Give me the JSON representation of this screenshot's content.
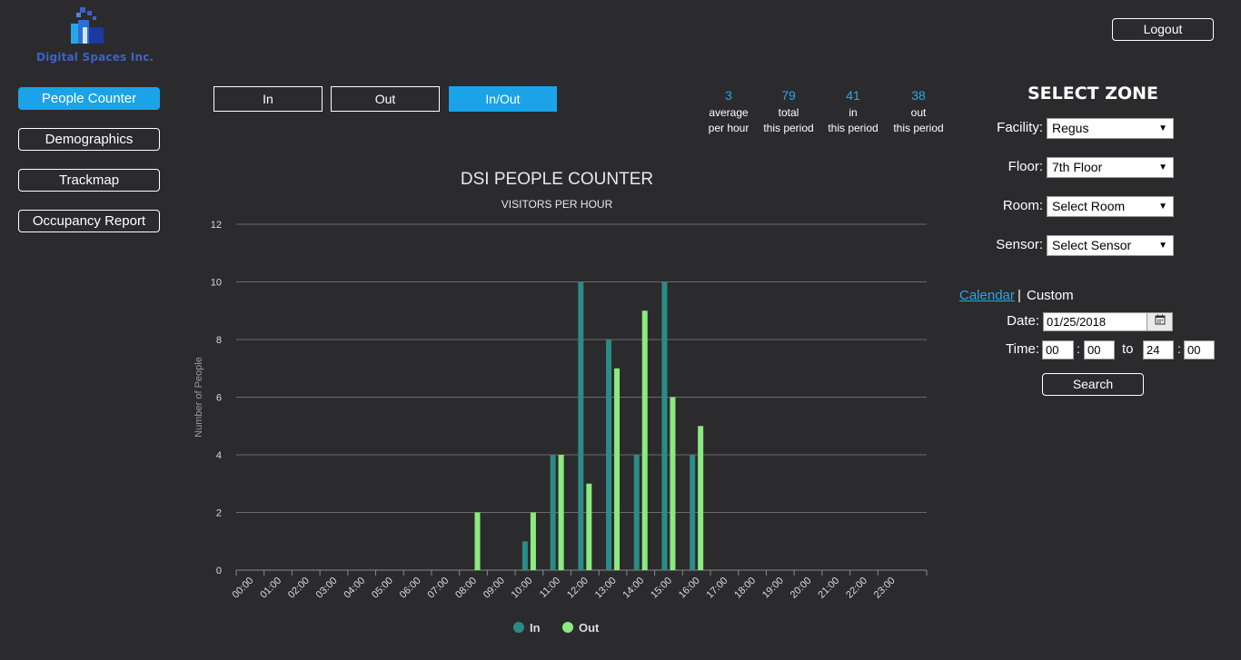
{
  "logo": {
    "text": "Digital Spaces Inc."
  },
  "header": {
    "logout_label": "Logout"
  },
  "nav": [
    {
      "label": "People Counter",
      "active": true
    },
    {
      "label": "Demographics",
      "active": false
    },
    {
      "label": "Trackmap",
      "active": false
    },
    {
      "label": "Occupancy Report",
      "active": false
    }
  ],
  "modes": [
    {
      "label": "In",
      "active": false
    },
    {
      "label": "Out",
      "active": false
    },
    {
      "label": "In/Out",
      "active": true
    }
  ],
  "stats": [
    {
      "value": "3",
      "line1": "average",
      "line2": "per hour"
    },
    {
      "value": "79",
      "line1": "total",
      "line2": "this period"
    },
    {
      "value": "41",
      "line1": "in",
      "line2": "this period"
    },
    {
      "value": "38",
      "line1": "out",
      "line2": "this period"
    }
  ],
  "zone": {
    "title": "SELECT ZONE",
    "facility_label": "Facility:",
    "facility_value": "Regus",
    "floor_label": "Floor:",
    "floor_value": "7th Floor",
    "room_label": "Room:",
    "room_value": "Select Room",
    "sensor_label": "Sensor:",
    "sensor_value": "Select Sensor",
    "calendar_link": "Calendar",
    "separator": "|",
    "custom_label": "Custom",
    "date_label": "Date:",
    "date_value": "01/25/2018",
    "time_label": "Time:",
    "time_from_h": "00",
    "time_from_m": "00",
    "to_label": "to",
    "time_to_h": "24",
    "time_to_m": "00",
    "colon": ":",
    "search_label": "Search"
  },
  "colors": {
    "accent": "#1aa3e8",
    "in": "#2a8c85",
    "out": "#8cea80",
    "stat": "#2aa6e8"
  },
  "chart_data": {
    "type": "bar",
    "title": "DSI PEOPLE COUNTER",
    "subtitle": "VISITORS PER HOUR",
    "ylabel": "Number of People",
    "xlabel": "",
    "ylim": [
      0,
      12
    ],
    "yticks": [
      0,
      2,
      4,
      6,
      8,
      10,
      12
    ],
    "grid": true,
    "legend": "bottom-center",
    "categories": [
      "00:00",
      "01:00",
      "02:00",
      "03:00",
      "04:00",
      "05:00",
      "06:00",
      "07:00",
      "08:00",
      "09:00",
      "10:00",
      "11:00",
      "12:00",
      "13:00",
      "14:00",
      "15:00",
      "16:00",
      "17:00",
      "18:00",
      "19:00",
      "20:00",
      "21:00",
      "22:00",
      "23:00"
    ],
    "series": [
      {
        "name": "In",
        "values": [
          0,
          0,
          0,
          0,
          0,
          0,
          0,
          0,
          0,
          0,
          1,
          4,
          10,
          8,
          4,
          10,
          4,
          0,
          0,
          0,
          0,
          0,
          0,
          0
        ]
      },
      {
        "name": "Out",
        "values": [
          0,
          0,
          0,
          0,
          0,
          0,
          0,
          0,
          2,
          0,
          2,
          4,
          3,
          7,
          9,
          6,
          5,
          0,
          0,
          0,
          0,
          0,
          0,
          0
        ]
      }
    ]
  }
}
